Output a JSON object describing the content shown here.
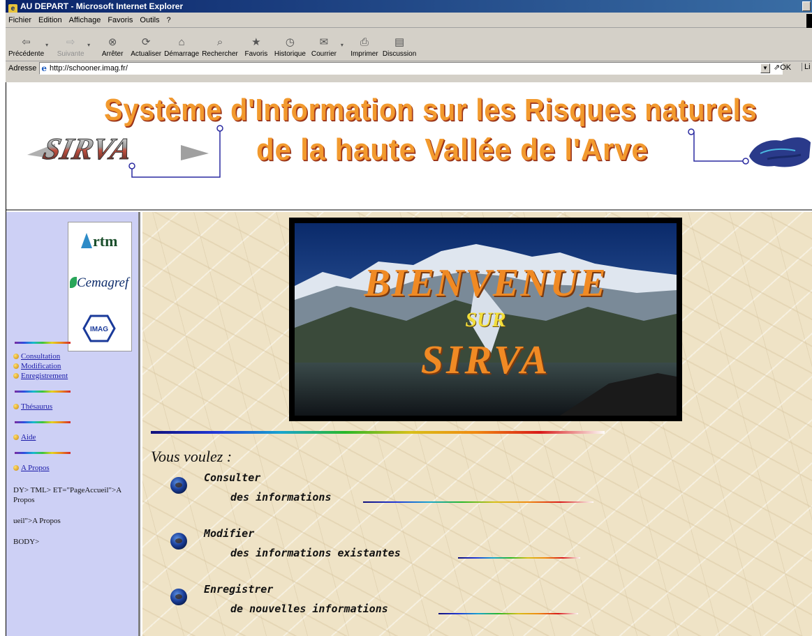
{
  "window": {
    "title": "AU DEPART - Microsoft Internet Explorer"
  },
  "menu": {
    "items": [
      "Fichier",
      "Edition",
      "Affichage",
      "Favoris",
      "Outils",
      "?"
    ]
  },
  "toolbar": {
    "buttons": [
      {
        "label": "Précédente",
        "icon": "back-arrow-icon",
        "enabled": true
      },
      {
        "label": "Suivante",
        "icon": "forward-arrow-icon",
        "enabled": false
      },
      {
        "label": "Arrêter",
        "icon": "stop-icon",
        "enabled": true
      },
      {
        "label": "Actualiser",
        "icon": "refresh-icon",
        "enabled": true
      },
      {
        "label": "Démarrage",
        "icon": "home-icon",
        "enabled": true
      },
      {
        "label": "Rechercher",
        "icon": "search-icon",
        "enabled": true
      },
      {
        "label": "Favoris",
        "icon": "favorites-icon",
        "enabled": true
      },
      {
        "label": "Historique",
        "icon": "history-icon",
        "enabled": true
      },
      {
        "label": "Courrier",
        "icon": "mail-icon",
        "enabled": true
      },
      {
        "label": "Imprimer",
        "icon": "print-icon",
        "enabled": true
      },
      {
        "label": "Discussion",
        "icon": "discussion-icon",
        "enabled": true
      }
    ]
  },
  "address": {
    "label": "Adresse",
    "url": "http://schooner.imag.fr/",
    "go_label": "OK",
    "links_label": "Li"
  },
  "header": {
    "title_line1": "Système d'Information sur les Risques naturels",
    "title_line2": "de la haute Vallée de l'Arve",
    "logo_text": "SIRVA"
  },
  "sidebar": {
    "partner_logos": {
      "rtm": "rtm",
      "cemagref": "Cemagref",
      "imag": "IMAG"
    },
    "links": {
      "consultation": "Consultation",
      "modification": "Modification",
      "enregistrement": "Enregistrement",
      "thesaurus": "Thésaurus",
      "aide": "Aide",
      "apropos": "A Propos"
    },
    "stray_text": {
      "line1": "DY> TML> ET=\"PageAccueil\">A Propos",
      "line2": "ueil\">A Propos",
      "line3": "BODY>"
    }
  },
  "main": {
    "welcome": {
      "line1": "BIENVENUE",
      "line2": "SUR",
      "line3": "SIRVA"
    },
    "prompt": "Vous voulez :",
    "choices": [
      {
        "action": "Consulter",
        "detail": "des informations"
      },
      {
        "action": "Modifier",
        "detail": "des informations existantes"
      },
      {
        "action": "Enregistrer",
        "detail": "de nouvelles informations"
      }
    ]
  },
  "colors": {
    "title_orange": "#f29a2e",
    "sidebar_bg": "#cdd0f5",
    "link_blue": "#1a1aa8",
    "chrome_gray": "#d4d0c8"
  }
}
